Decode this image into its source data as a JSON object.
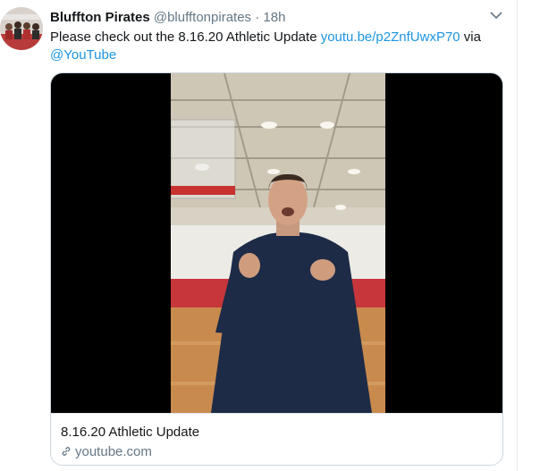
{
  "tweet": {
    "display_name": "Bluffton Pirates",
    "handle": "@blufftonpirates",
    "separator": "·",
    "time": "18h",
    "text_prefix": "Please check out the 8.16.20 Athletic Update ",
    "link_text": "youtu.be/p2ZnfUwxP70",
    "text_middle": " via",
    "mention": "@YouTube"
  },
  "card": {
    "title": "8.16.20 Athletic Update",
    "domain": "youtube.com",
    "domain_icon": "link-icon"
  },
  "icons": {
    "menu": "chevron-down-icon",
    "avatar": "team-photo-avatar"
  },
  "colors": {
    "link": "#1b95e0",
    "secondary_text": "#657786",
    "border": "#ccd6dd"
  }
}
